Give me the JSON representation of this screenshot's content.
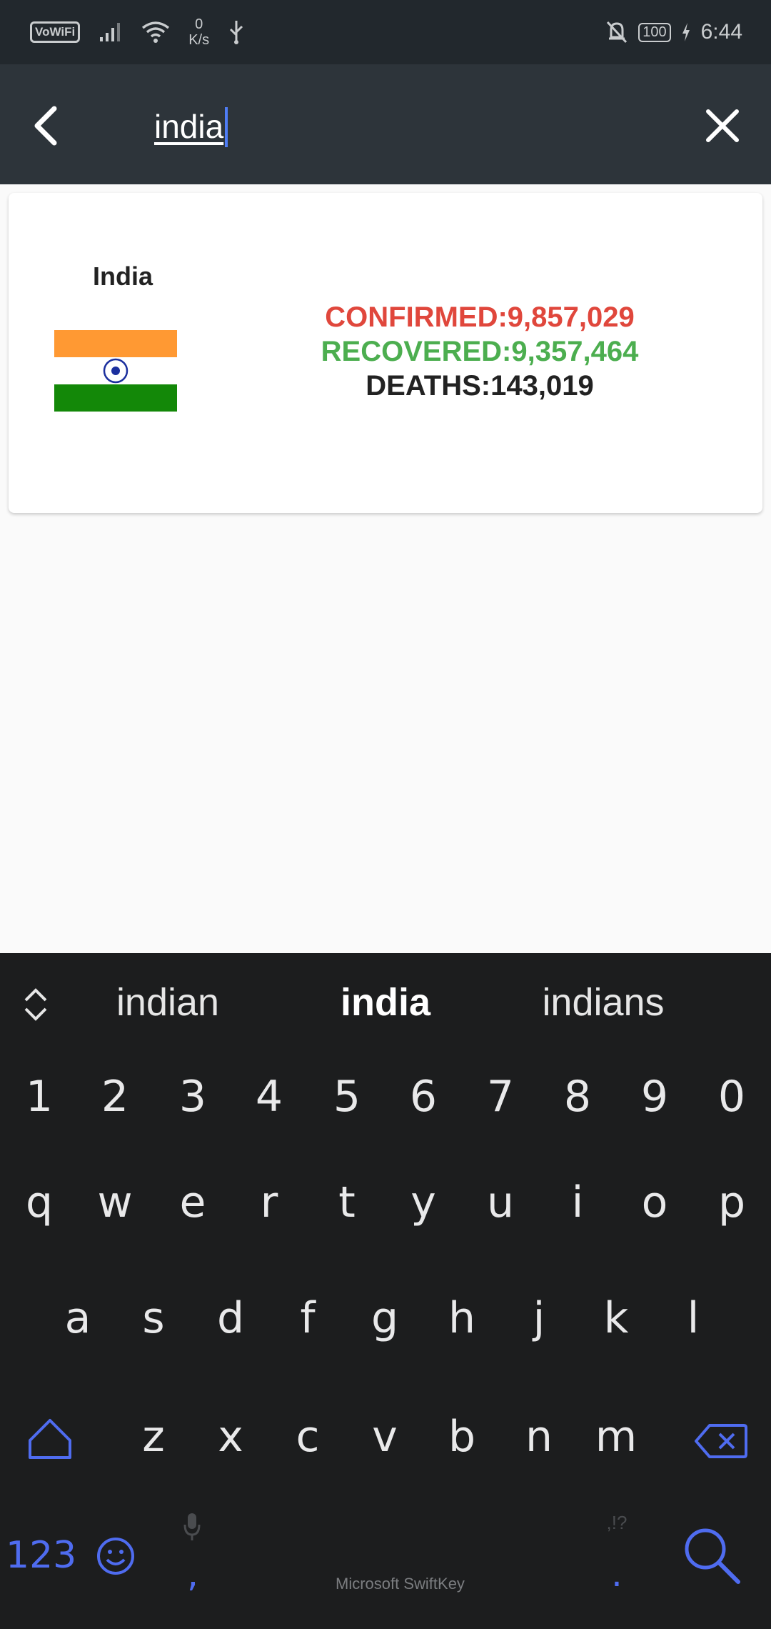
{
  "status_bar": {
    "vowifi": "VoWiFi",
    "net_speed_value": "0",
    "net_speed_unit": "K/s",
    "battery": "100",
    "time": "6:44"
  },
  "search": {
    "query": "india"
  },
  "result_card": {
    "country": "India",
    "confirmed": "CONFIRMED:9,857,029",
    "recovered": "RECOVERED:9,357,464",
    "deaths": "DEATHS:143,019"
  },
  "keyboard": {
    "suggestions": [
      "indian",
      "india",
      "indians"
    ],
    "number_row": [
      "1",
      "2",
      "3",
      "4",
      "5",
      "6",
      "7",
      "8",
      "9",
      "0"
    ],
    "row1": [
      "q",
      "w",
      "e",
      "r",
      "t",
      "y",
      "u",
      "i",
      "o",
      "p"
    ],
    "row2": [
      "a",
      "s",
      "d",
      "f",
      "g",
      "h",
      "j",
      "k",
      "l"
    ],
    "row3": [
      "z",
      "x",
      "c",
      "v",
      "b",
      "n",
      "m"
    ],
    "numbers_key": "123",
    "comma_key": ",",
    "period_key": ".",
    "punct_hint": ",!?",
    "brand": "Microsoft SwiftKey"
  },
  "colors": {
    "status_bar_bg": "#22282d",
    "toolbar_bg": "#2d343a",
    "confirmed": "#e0473c",
    "recovered": "#4cae4f",
    "keyboard_bg": "#1c1d1e",
    "keyboard_accent": "#4f6cf0"
  }
}
